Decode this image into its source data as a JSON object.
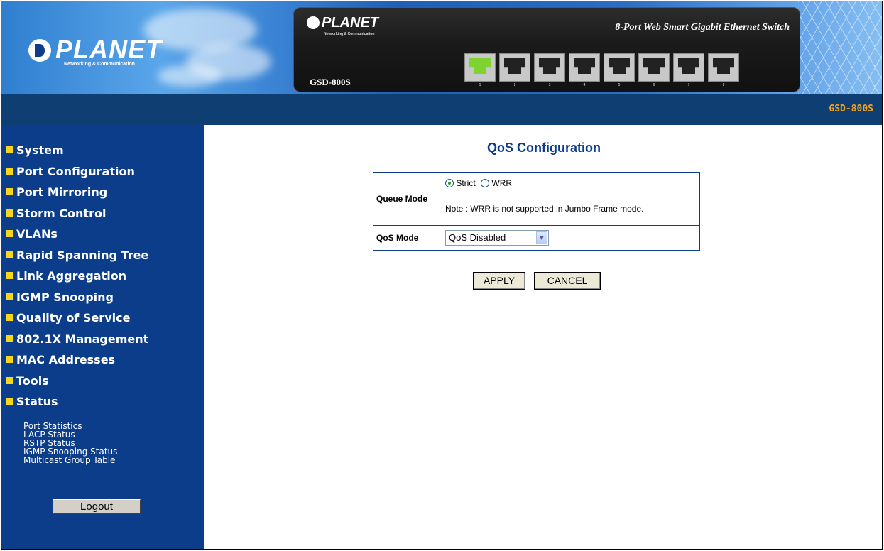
{
  "header": {
    "logo_text": "PLANET",
    "logo_tagline": "Networking & Communication",
    "device_logo": "PLANET",
    "device_tagline": "Networking & Communication",
    "device_title": "8-Port Web Smart Gigabit Ethernet Switch",
    "device_model": "GSD-800S",
    "ports": [
      "1",
      "2",
      "3",
      "4",
      "5",
      "6",
      "7",
      "8"
    ],
    "active_port": "1"
  },
  "strip": {
    "model": "GSD-800S"
  },
  "sidebar": {
    "items": [
      {
        "label": "System"
      },
      {
        "label": "Port Configuration"
      },
      {
        "label": "Port Mirroring"
      },
      {
        "label": "Storm Control"
      },
      {
        "label": "VLANs"
      },
      {
        "label": "Rapid Spanning Tree"
      },
      {
        "label": "Link Aggregation"
      },
      {
        "label": "IGMP Snooping"
      },
      {
        "label": "Quality of Service"
      },
      {
        "label": "802.1X Management"
      },
      {
        "label": "MAC Addresses"
      },
      {
        "label": "Tools"
      },
      {
        "label": "Status"
      }
    ],
    "subitems": [
      {
        "label": "Port Statistics"
      },
      {
        "label": "LACP Status"
      },
      {
        "label": "RSTP Status"
      },
      {
        "label": "IGMP Snooping Status"
      },
      {
        "label": "Multicast Group Table"
      }
    ],
    "logout_label": "Logout"
  },
  "main": {
    "title": "QoS Configuration",
    "queue_mode_label": "Queue Mode",
    "option_strict": "Strict",
    "option_wrr": "WRR",
    "selected_queue_mode": "Strict",
    "note": "Note : WRR is not supported in Jumbo Frame mode.",
    "qos_mode_label": "QoS Mode",
    "qos_mode_value": "QoS Disabled",
    "apply_label": "APPLY",
    "cancel_label": "CANCEL"
  },
  "colors": {
    "sidebar_bg": "#0c3d8b",
    "strip_bg": "#0f3e73",
    "model_text": "#f3a31c",
    "nav_bullet": "#f7d61c",
    "title_text": "#0c3d8b"
  }
}
